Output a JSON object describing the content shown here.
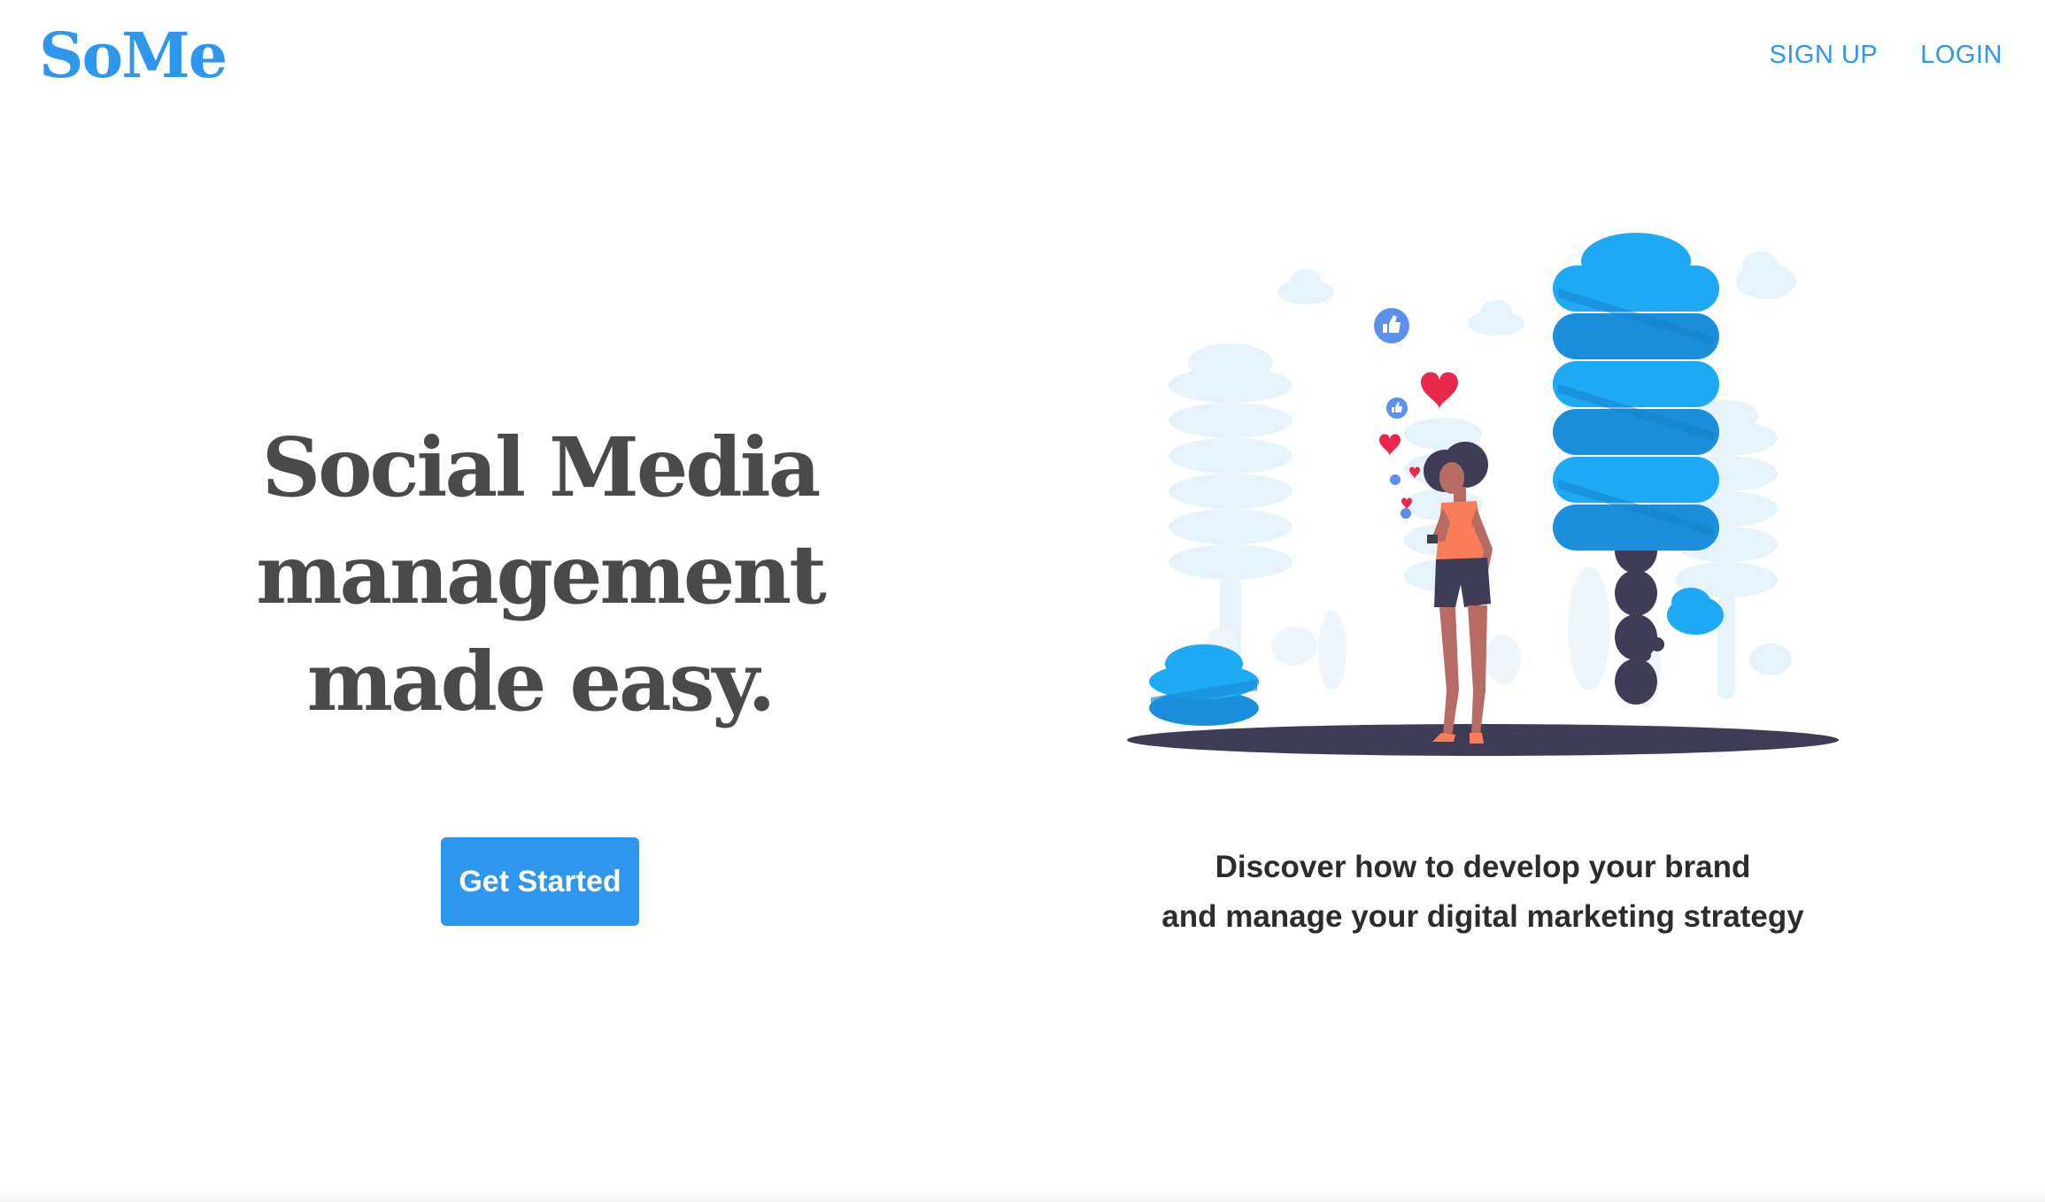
{
  "header": {
    "logo_text": "SoMe",
    "nav": {
      "signup_label": "SIGN UP",
      "login_label": "LOGIN"
    }
  },
  "hero": {
    "headline": {
      "line1": "Social Media",
      "line2": "management",
      "line3": "made easy."
    },
    "cta_label": "Get Started",
    "tagline": {
      "line1": "Discover how to develop your brand",
      "line2": "and manage your digital marketing strategy"
    },
    "illustration": {
      "subject": "woman-on-phone-with-likes",
      "icons": [
        "thumbs-up-icon",
        "heart-icon"
      ]
    }
  },
  "colors": {
    "brand": "#2f96ee",
    "headline": "#4a4a4a",
    "tree_blue": "#1ea9f5",
    "tree_blue_dark": "#1b8fdc",
    "tree_faint": "#e6f3fb",
    "ground": "#3f3d56",
    "heart": "#e8274b",
    "like": "#5b8ff0",
    "shirt": "#fa7d5a",
    "skin": "#b86b62"
  }
}
